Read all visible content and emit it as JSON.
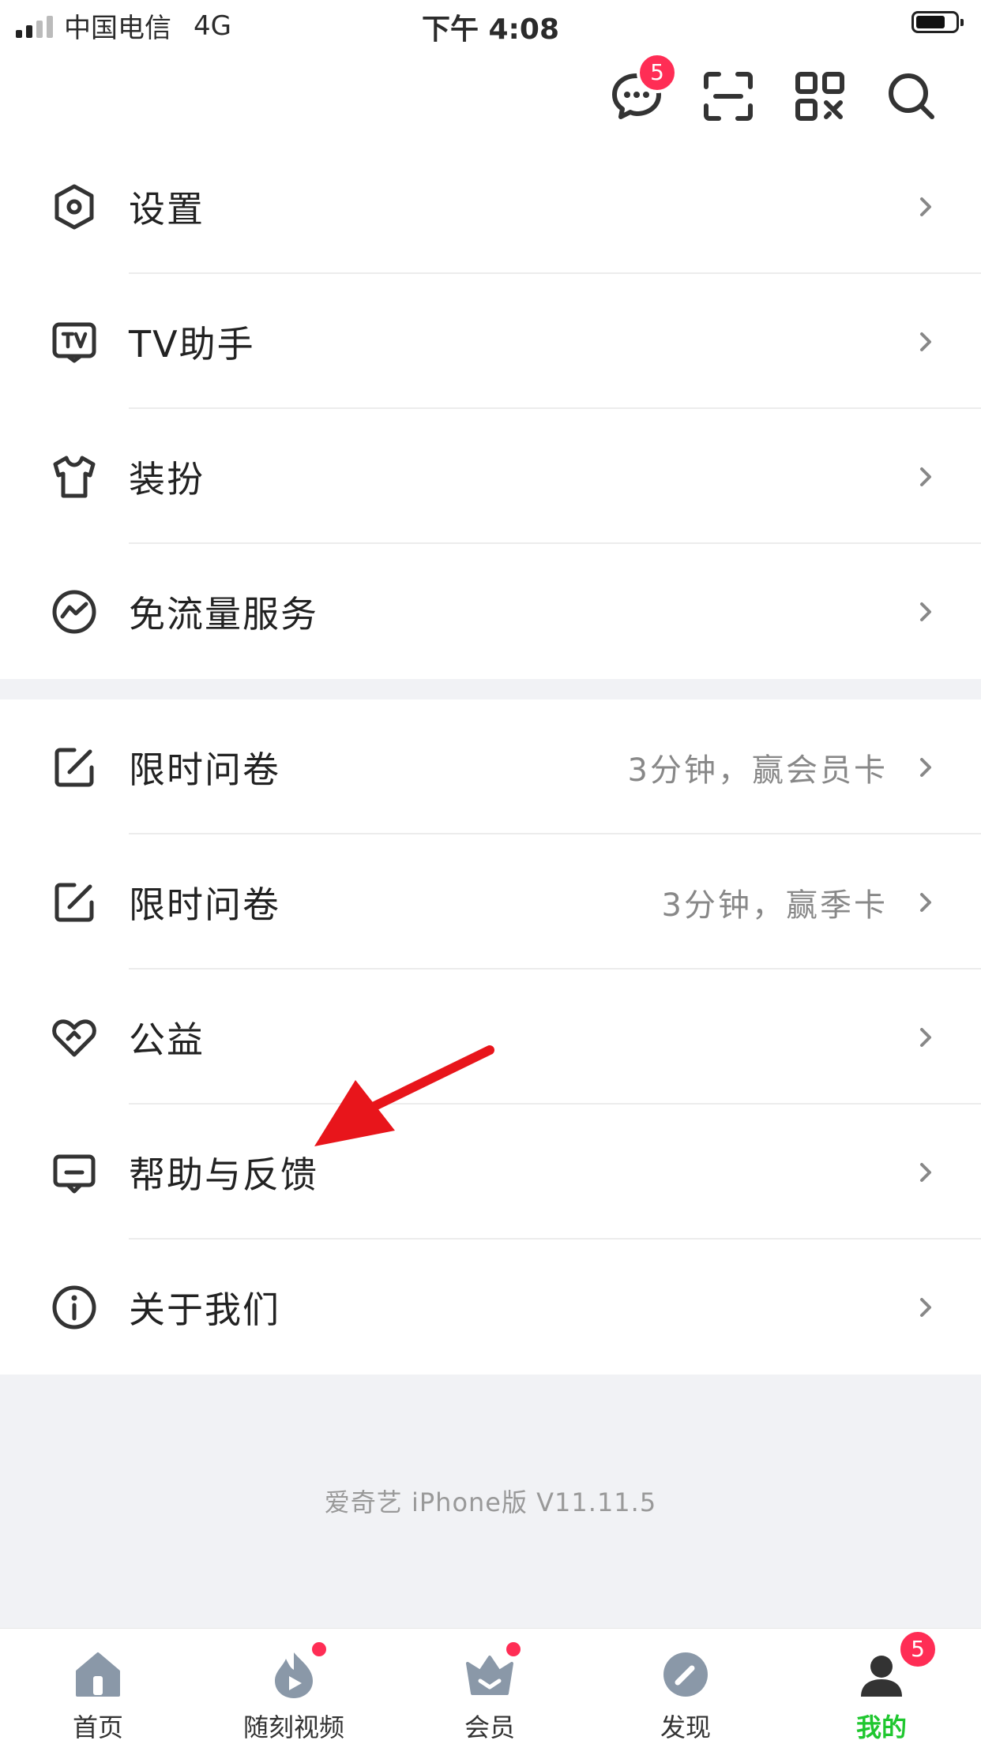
{
  "status_bar": {
    "carrier": "中国电信",
    "network": "4G",
    "time": "下午 4:08"
  },
  "top_bar": {
    "message_badge": "5",
    "icons": [
      "message-icon",
      "scan-icon",
      "qr-code-icon",
      "search-icon"
    ]
  },
  "menu_group_1": [
    {
      "label": "设置",
      "icon": "settings-icon"
    },
    {
      "label": "TV助手",
      "icon": "tv-icon"
    },
    {
      "label": "装扮",
      "icon": "tshirt-icon"
    },
    {
      "label": "免流量服务",
      "icon": "free-data-icon"
    }
  ],
  "menu_group_2": [
    {
      "label": "限时问卷",
      "value": "3分钟，赢会员卡",
      "icon": "edit-icon"
    },
    {
      "label": "限时问卷",
      "value": "3分钟，赢季卡",
      "icon": "edit-icon"
    },
    {
      "label": "公益",
      "icon": "heart-icon"
    },
    {
      "label": "帮助与反馈",
      "icon": "feedback-icon"
    },
    {
      "label": "关于我们",
      "icon": "info-icon"
    }
  ],
  "version_text": "爱奇艺 iPhone版 V11.11.5",
  "tab_bar": {
    "tabs": [
      {
        "label": "首页",
        "icon": "home-icon"
      },
      {
        "label": "随刻视频",
        "icon": "flame-play-icon"
      },
      {
        "label": "会员",
        "icon": "crown-icon"
      },
      {
        "label": "发现",
        "icon": "compass-icon"
      },
      {
        "label": "我的",
        "icon": "profile-icon"
      }
    ],
    "profile_badge": "5",
    "active_color": "#1fc72f"
  },
  "colors": {
    "badge": "#ff2d55",
    "annotation_arrow": "#e8151b",
    "section_gap": "#f1f2f5"
  }
}
